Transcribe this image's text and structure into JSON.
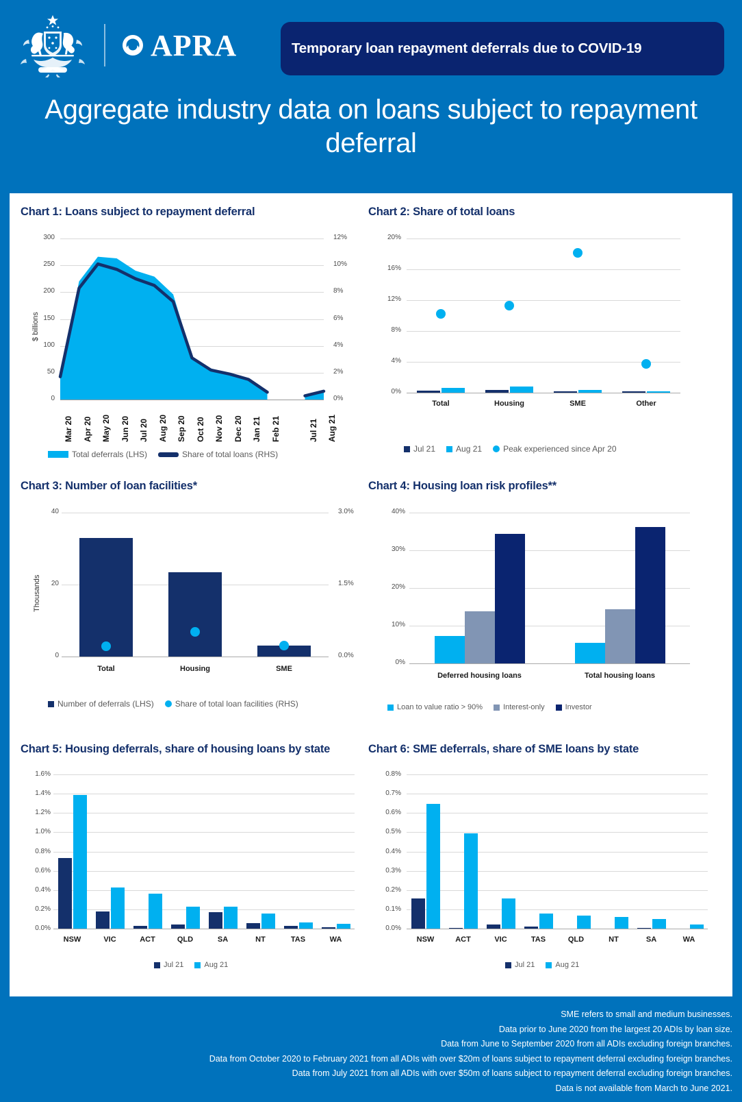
{
  "header": {
    "org_name": "APRA",
    "badge_text": "Temporary loan repayment deferrals due to COVID-19",
    "title": "Aggregate industry data on loans subject to repayment deferral"
  },
  "colors": {
    "brand_blue": "#0072BC",
    "navy": "#14306B",
    "dark_navy": "#0A2470",
    "light_blue": "#00B0F0",
    "grey_blue": "#8195B4",
    "white": "#FFFFFF"
  },
  "footnotes": [
    "SME refers to small and medium businesses.",
    "Data prior to June 2020 from the largest 20 ADIs by loan size.",
    "Data from June to September 2020 from all ADIs excluding  foreign branches.",
    "Data from October 2020 to February 2021 from all ADIs with over $20m of loans subject to repayment deferral excluding  foreign branches.",
    "Data from July 2021 from all ADIs with over $50m of loans subject to repayment deferral excluding  foreign branches.",
    "Data is not available from March to June 2021."
  ],
  "chart_data": [
    {
      "id": "chart1",
      "type": "area",
      "title": "Chart 1: Loans subject to repayment deferral",
      "xlabel": "",
      "ylabel": "$ billions",
      "y2label": "",
      "categories": [
        "Mar 20",
        "Apr 20",
        "May 20",
        "Jun 20",
        "Jul 20",
        "Aug 20",
        "Sep 20",
        "Oct 20",
        "Nov 20",
        "Dec 20",
        "Jan 21",
        "Feb 21",
        "",
        "Jul 21",
        "Aug 21"
      ],
      "ylim": [
        0,
        300
      ],
      "y2lim": [
        0,
        12
      ],
      "yticks": [
        "0",
        "50",
        "100",
        "150",
        "200",
        "250",
        "300"
      ],
      "y2ticks": [
        "0%",
        "2%",
        "4%",
        "6%",
        "8%",
        "10%",
        "12%"
      ],
      "series": [
        {
          "name": "Total deferrals (LHS)",
          "color": "#00B0F0",
          "axis": "left",
          "values": [
            45,
            220,
            266,
            263,
            240,
            229,
            196,
            80,
            58,
            48,
            38,
            14,
            null,
            7,
            16
          ]
        },
        {
          "name": "Share of total loans (RHS)",
          "color": "#14306B",
          "axis": "right",
          "values": [
            1.7,
            8.3,
            10.1,
            9.7,
            9.0,
            8.5,
            7.3,
            3.1,
            2.2,
            1.9,
            1.5,
            0.55,
            null,
            0.28,
            0.62
          ]
        }
      ],
      "legend": [
        "Total deferrals (LHS)",
        "Share of total loans (RHS)"
      ]
    },
    {
      "id": "chart2",
      "type": "bar",
      "title": "Chart 2: Share of total loans",
      "categories": [
        "Total",
        "Housing",
        "SME",
        "Other"
      ],
      "ylim": [
        0,
        20
      ],
      "yticks": [
        "0%",
        "4%",
        "8%",
        "12%",
        "16%",
        "20%"
      ],
      "series": [
        {
          "name": "Jul 21",
          "color": "#14306B",
          "values": [
            0.27,
            0.37,
            0.06,
            0.04
          ]
        },
        {
          "name": "Aug 21",
          "color": "#00B0F0",
          "values": [
            0.62,
            0.76,
            0.33,
            0.06
          ]
        },
        {
          "name": "Peak experienced since Apr 20",
          "color": "#00B0F0",
          "type": "dot",
          "values": [
            10.2,
            11.3,
            18.1,
            3.7
          ]
        }
      ],
      "legend": [
        "Jul 21",
        "Aug 21",
        "Peak experienced since Apr 20"
      ]
    },
    {
      "id": "chart3",
      "type": "bar",
      "title": "Chart 3: Number of loan facilities*",
      "ylabel": "Thousands",
      "categories": [
        "Total",
        "Housing",
        "SME"
      ],
      "ylim": [
        0,
        40
      ],
      "y2lim": [
        0,
        3.0
      ],
      "yticks": [
        "0",
        "20",
        "40"
      ],
      "y2ticks": [
        "0.0%",
        "1.5%",
        "3.0%"
      ],
      "series": [
        {
          "name": "Number of deferrals (LHS)",
          "color": "#14306B",
          "axis": "left",
          "values": [
            33.0,
            23.4,
            3.1
          ]
        },
        {
          "name": "Share of total loan facilities (RHS)",
          "color": "#00B0F0",
          "axis": "right",
          "type": "dot",
          "values": [
            0.21,
            0.52,
            0.23
          ]
        }
      ],
      "legend": [
        "Number of deferrals (LHS)",
        "Share of total loan facilities (RHS)"
      ]
    },
    {
      "id": "chart4",
      "type": "bar",
      "title": "Chart 4: Housing loan risk profiles**",
      "categories": [
        "Deferred housing loans",
        "Total housing loans"
      ],
      "ylim": [
        0,
        40
      ],
      "yticks": [
        "0%",
        "10%",
        "20%",
        "30%",
        "40%"
      ],
      "series": [
        {
          "name": "Loan to value ratio > 90%",
          "color": "#00B0F0",
          "values": [
            7.3,
            5.4
          ]
        },
        {
          "name": "Interest-only",
          "color": "#8195B4",
          "values": [
            13.8,
            14.3
          ]
        },
        {
          "name": "Investor",
          "color": "#0A2470",
          "values": [
            34.4,
            36.1
          ]
        }
      ],
      "legend": [
        "Loan to value ratio > 90%",
        "Interest-only",
        "Investor"
      ]
    },
    {
      "id": "chart5",
      "type": "bar",
      "title": "Chart 5: Housing deferrals, share of housing loans by state",
      "categories": [
        "NSW",
        "VIC",
        "ACT",
        "QLD",
        "SA",
        "NT",
        "TAS",
        "WA"
      ],
      "ylim": [
        0,
        1.6
      ],
      "yticks": [
        "0.0%",
        "0.2%",
        "0.4%",
        "0.6%",
        "0.8%",
        "1.0%",
        "1.2%",
        "1.4%",
        "1.6%"
      ],
      "series": [
        {
          "name": "Jul 21",
          "color": "#14306B",
          "values": [
            0.73,
            0.175,
            0.028,
            0.04,
            0.17,
            0.055,
            0.028,
            0.015
          ]
        },
        {
          "name": "Aug 21",
          "color": "#00B0F0",
          "values": [
            1.385,
            0.43,
            0.36,
            0.23,
            0.23,
            0.155,
            0.065,
            0.05
          ]
        }
      ],
      "legend": [
        "Jul 21",
        "Aug 21"
      ]
    },
    {
      "id": "chart6",
      "type": "bar",
      "title": "Chart 6: SME deferrals, share of SME loans by state",
      "categories": [
        "NSW",
        "ACT",
        "VIC",
        "TAS",
        "QLD",
        "NT",
        "SA",
        "WA"
      ],
      "ylim": [
        0,
        0.8
      ],
      "yticks": [
        "0.0%",
        "0.1%",
        "0.2%",
        "0.3%",
        "0.4%",
        "0.5%",
        "0.6%",
        "0.7%",
        "0.8%"
      ],
      "series": [
        {
          "name": "Jul 21",
          "color": "#14306B",
          "values": [
            0.158,
            0.005,
            0.023,
            0.01,
            0.0,
            0.0,
            0.005,
            0.0
          ]
        },
        {
          "name": "Aug 21",
          "color": "#00B0F0",
          "values": [
            0.648,
            0.494,
            0.158,
            0.078,
            0.068,
            0.06,
            0.05,
            0.021
          ]
        }
      ],
      "legend": [
        "Jul 21",
        "Aug 21"
      ]
    }
  ]
}
